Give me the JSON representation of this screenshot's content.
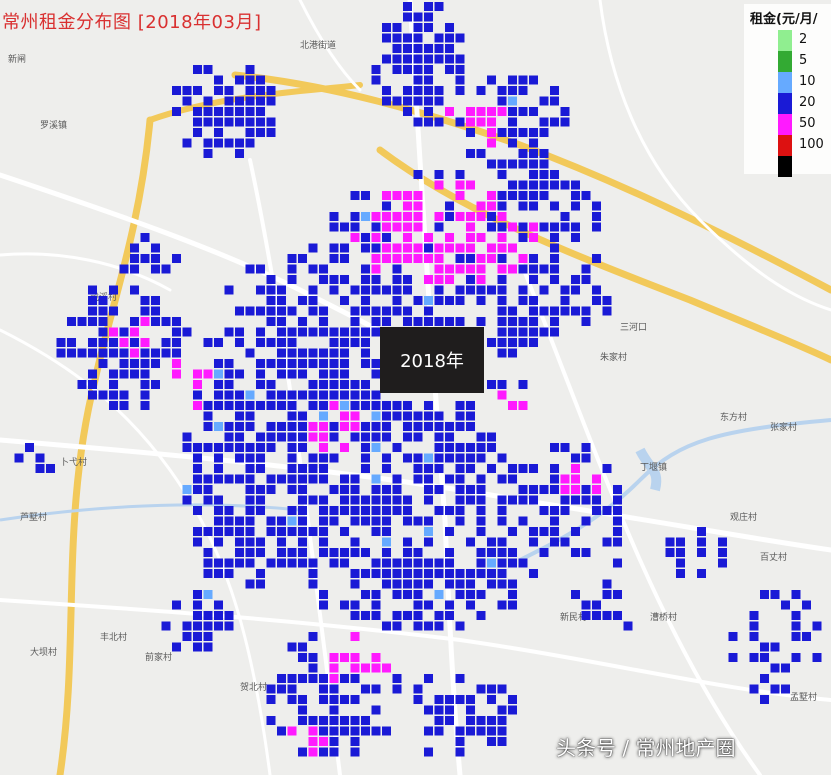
{
  "title": "常州租金分布图 [2018年03月]",
  "year_label": "2018年",
  "watermark": "头条号 / 常州地产圈",
  "legend": {
    "title": "租金(元/月/",
    "items": [
      {
        "label": "2",
        "color": "#90ee90"
      },
      {
        "label": "5",
        "color": "#33aa33"
      },
      {
        "label": "10",
        "color": "#66aaff"
      },
      {
        "label": "20",
        "color": "#1a1ad6"
      },
      {
        "label": "50",
        "color": "#ff1aff"
      },
      {
        "label": "100",
        "color": "#dd1111"
      },
      {
        "label": "",
        "color": "#000000"
      }
    ]
  },
  "place_names": [
    "新闸",
    "罗溪镇",
    "北港街道",
    "丁堰镇",
    "卜弋村",
    "丰北村",
    "大坝村",
    "贺北村",
    "前家村",
    "东方村",
    "孟墅村",
    "新民村",
    "漕桥村",
    "百丈村",
    "张家村",
    "朱家村",
    "三河口",
    "观庄村",
    "芦墅村",
    "戴溪村"
  ]
}
